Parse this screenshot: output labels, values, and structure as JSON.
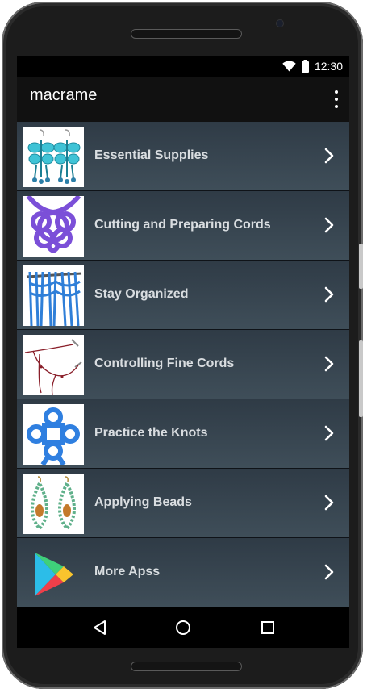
{
  "status_bar": {
    "time": "12:30"
  },
  "app_bar": {
    "title": "macrame"
  },
  "list": {
    "items": [
      {
        "label": "Essential Supplies"
      },
      {
        "label": "Cutting and Preparing Cords"
      },
      {
        "label": "Stay Organized"
      },
      {
        "label": "Controlling Fine Cords"
      },
      {
        "label": "Practice the Knots"
      },
      {
        "label": "Applying Beads"
      },
      {
        "label": "More Apss"
      }
    ]
  },
  "colors": {
    "list_bg": "#3a4853",
    "item_text": "#d9dde0",
    "app_bar": "#111111"
  }
}
